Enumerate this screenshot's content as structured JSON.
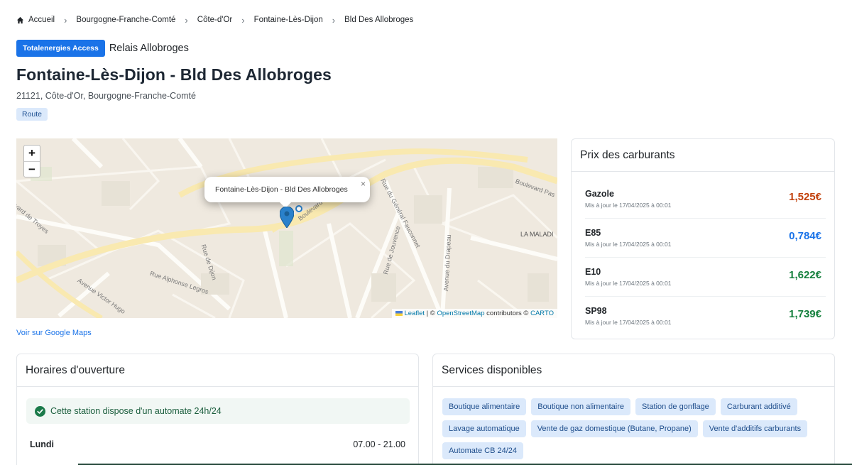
{
  "breadcrumb": {
    "items": [
      "Accueil",
      "Bourgogne-Franche-Comté",
      "Côte-d'Or",
      "Fontaine-Lès-Dijon",
      "Bld Des Allobroges"
    ],
    "home_icon": "home-icon",
    "separator_icon": "chevron-right-icon"
  },
  "brand": {
    "badge": "Totalenergies Access",
    "station": "Relais Allobroges",
    "badge_color": "#1a73e8"
  },
  "title": "Fontaine-Lès-Dijon - Bld Des Allobroges",
  "address": "21121, Côte-d'Or, Bourgogne-Franche-Comté",
  "route_badge": "Route",
  "map": {
    "zoom_in": "+",
    "zoom_out": "−",
    "popup_title": "Fontaine-Lès-Dijon - Bld Des Allobroges",
    "popup_close": "×",
    "attribution": {
      "leaflet": "Leaflet",
      "sep1": " | © ",
      "osm": "OpenStreetMap",
      "contributors": " contributors © ",
      "carto": "CARTO"
    },
    "labels": {
      "bd_pasteur": "Boulevard Pas",
      "bd_allobroges": "Boulevard d",
      "rue_general": "Rue du Général Fauconnet",
      "la_maladiere": "LA MALADI",
      "av_drapeau": "Avenue du Drapeau",
      "rue_dijon": "Rue de Dijon",
      "rue_alphonse": "Rue Alphonse Legros",
      "av_victor": "Avenue Victor Hugo",
      "rue_troyes": "vard de Troyes",
      "rue_jouvence": "Rue de Jouvence"
    }
  },
  "google_maps_link": "Voir sur Google Maps",
  "prices": {
    "header": "Prix des carburants",
    "fuels": [
      {
        "name": "Gazole",
        "updated": "Mis à jour le 17/04/2025 à 00:01",
        "price": "1,525€",
        "color": "#c2410c"
      },
      {
        "name": "E85",
        "updated": "Mis à jour le 17/04/2025 à 00:01",
        "price": "0,784€",
        "color": "#1a73e8"
      },
      {
        "name": "E10",
        "updated": "Mis à jour le 17/04/2025 à 00:01",
        "price": "1,622€",
        "color": "#15803d"
      },
      {
        "name": "SP98",
        "updated": "Mis à jour le 17/04/2025 à 00:01",
        "price": "1,739€",
        "color": "#15803d"
      }
    ]
  },
  "hours": {
    "header": "Horaires d'ouverture",
    "automate_notice": "Cette station dispose d'un automate 24h/24",
    "days": [
      {
        "day": "Lundi",
        "time": "07.00 - 21.00"
      }
    ]
  },
  "services": {
    "header": "Services disponibles",
    "items": [
      "Boutique alimentaire",
      "Boutique non alimentaire",
      "Station de gonflage",
      "Carburant additivé",
      "Lavage automatique",
      "Vente de gaz domestique (Butane, Propane)",
      "Vente d'additifs carburants",
      "Automate CB 24/24"
    ]
  }
}
